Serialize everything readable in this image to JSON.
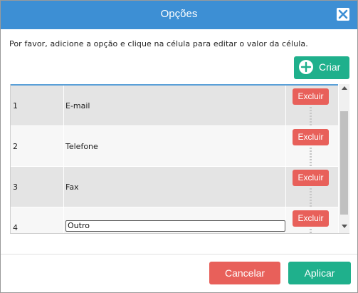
{
  "dialog": {
    "title": "Opções",
    "instruction": "Por favor, adicione a opção e clique na célula para editar o valor da célula.",
    "close_icon": "close-icon"
  },
  "toolbar": {
    "create_label": "Criar",
    "create_icon": "plus-circle-icon"
  },
  "rows": [
    {
      "num": "1",
      "value": "E-mail",
      "delete_label": "Excluir"
    },
    {
      "num": "2",
      "value": "Telefone",
      "delete_label": "Excluir"
    },
    {
      "num": "3",
      "value": "Fax",
      "delete_label": "Excluir"
    },
    {
      "num": "4",
      "value": "Outro",
      "delete_label": "Excluir",
      "editing": true
    }
  ],
  "footer": {
    "cancel_label": "Cancelar",
    "apply_label": "Aplicar"
  },
  "colors": {
    "titlebar": "#3d8fd4",
    "primary": "#1fb08c",
    "danger": "#e8605a"
  }
}
